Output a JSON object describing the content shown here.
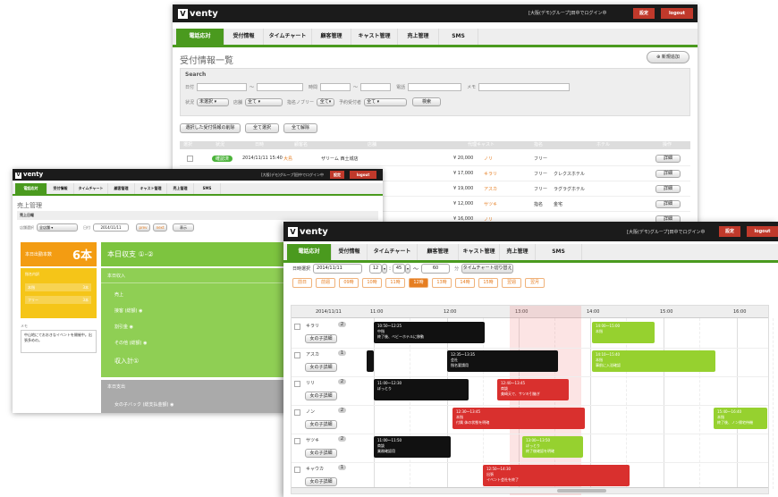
{
  "app": {
    "logo": "venty",
    "user": "[大阪(デモ)グループ]田中でログイン中",
    "settings": "設定",
    "logout": "logout"
  },
  "tabs": [
    "電話応対",
    "受付情報",
    "タイムチャート",
    "顧客管理",
    "キャスト管理",
    "売上管理",
    "SMS"
  ],
  "winA": {
    "title": "受付情報一覧",
    "new_button": "新規追加",
    "search_title": "Search",
    "labels": {
      "date": "日付",
      "time": "時間",
      "status": "状況",
      "status_val": "未選択",
      "shop": "店舗",
      "shop_val": "全て",
      "designate": "指名ノブリー",
      "designate_val": "全て",
      "acceptance": "予約受付者",
      "acceptance_val": "全て",
      "search_btn": "検索",
      "phone": "電話",
      "kana": "メモ"
    },
    "bulk": [
      "選択した受付情報の削除",
      "全て選択",
      "全て解除"
    ],
    "headers": [
      "選択",
      "状況",
      "日時",
      "顧客名",
      "店舗",
      "代理キャスト",
      "指名",
      "ホテル",
      "操作"
    ],
    "rows": [
      {
        "status": "確認済",
        "date": "2014/11/11 15:40",
        "cust": "大島",
        "shop": "ザリーム 西土城店",
        "price": "¥ 20,000",
        "cast": "ノリ",
        "nom": "フリー",
        "hotel": "",
        "op": "詳細"
      },
      {
        "date": "",
        "cust": "",
        "shop": "",
        "price": "¥ 17,000",
        "cast": "キラリ",
        "nom": "フリー",
        "hotel": "クレクスホテル",
        "op": "詳細"
      },
      {
        "price": "¥ 19,000",
        "cast": "アスカ",
        "nom": "フリー",
        "hotel": "ラグラグホテル",
        "op": "詳細"
      },
      {
        "price": "¥ 12,000",
        "cast": "サツキ",
        "nom": "指名",
        "hotel": "金宅",
        "op": "詳細"
      },
      {
        "price": "¥ 16,000",
        "cast": "ノリ",
        "nom": "",
        "hotel": "",
        "op": "詳細"
      }
    ]
  },
  "winB": {
    "title": "売上管理",
    "subtitle": "売上日報",
    "shop_label": "店舗選択",
    "shop_val": "全店舗",
    "date_label": "日付",
    "date_val": "2014/11/11",
    "prev": "prev",
    "next": "next",
    "go": "表示",
    "count_label": "本日出勤本数",
    "count_val": "6本",
    "breakdown_label": "指名内訳",
    "breakdown": [
      {
        "name": "本指",
        "val": "3本"
      },
      {
        "name": "フリー",
        "val": "3本"
      }
    ],
    "memo_label": "メモ",
    "memo": "中山地にておおきなイベントを開催中。出張多めの。",
    "income_title": "本日収支 ①-②",
    "income_sub": "本日収入",
    "income_items": [
      "売上",
      "接客 (総額)",
      "割引金",
      "その他 (総額)"
    ],
    "income_total": "収入計①",
    "expense_sub": "本日支出",
    "expense_item": "女の子バック (総支払金額)"
  },
  "winC": {
    "date_label": "日時選択",
    "date_val": "2014/11/11",
    "hour": "12",
    "minute": "45",
    "duration": "60",
    "unit": "分",
    "switch": "タイムチャート切り替え",
    "chips": [
      "前日",
      "前週",
      "09時",
      "10時",
      "11時",
      "12時",
      "13時",
      "14時",
      "15時",
      "翌週",
      "翌月"
    ],
    "chart_date": "2014/11/11",
    "hours": [
      "11:00",
      "12:00",
      "13:00",
      "14:00",
      "15:00",
      "16:00"
    ],
    "detail_btn": "女の子詳細",
    "staff": [
      {
        "name": "キラリ",
        "count": "2"
      },
      {
        "name": "アスカ",
        "count": "1"
      },
      {
        "name": "リリ",
        "count": "2"
      },
      {
        "name": "ノン",
        "count": "2"
      },
      {
        "name": "サツキ",
        "count": "2"
      },
      {
        "name": "キャウカ",
        "count": "1"
      }
    ],
    "events": [
      {
        "color": "k",
        "time": "10:50〜12:25",
        "note": "中指",
        "note2": "終了後、ベビーホテルに移動"
      },
      {
        "color": "g",
        "time": "14:00〜15:00",
        "note": "本指",
        "note2": ""
      },
      {
        "color": "k",
        "time": "12:35〜13:35",
        "note": "会社",
        "note2": "指名要請用"
      },
      {
        "color": "g",
        "time": "14:10〜15:40",
        "note": "本指",
        "note2": "事前に入浴確認"
      },
      {
        "color": "k",
        "time": "11:00〜12:30",
        "note": "ぽっとり",
        "note2": ""
      },
      {
        "color": "r",
        "time": "12:40〜13:45",
        "note": "商談",
        "note2": "美崎天で、サツキ引継ぎ"
      },
      {
        "color": "r",
        "time": "12:30〜13:45",
        "note": "本指",
        "note2": "付属 体の状態を明確"
      },
      {
        "color": "g",
        "time": "15:40〜16:40",
        "note": "本指",
        "note2": "終了後、ノン帰宅待機"
      },
      {
        "color": "k",
        "time": "11:00〜11:50",
        "note": "商談",
        "note2": "業務確認用"
      },
      {
        "color": "g",
        "time": "13:00〜13:50",
        "note": "ぽっとり",
        "note2": "終了後確認を明確"
      },
      {
        "color": "r",
        "time": "12:50〜14:30",
        "note": "出張",
        "note2": "イベント会社を終了"
      }
    ]
  }
}
